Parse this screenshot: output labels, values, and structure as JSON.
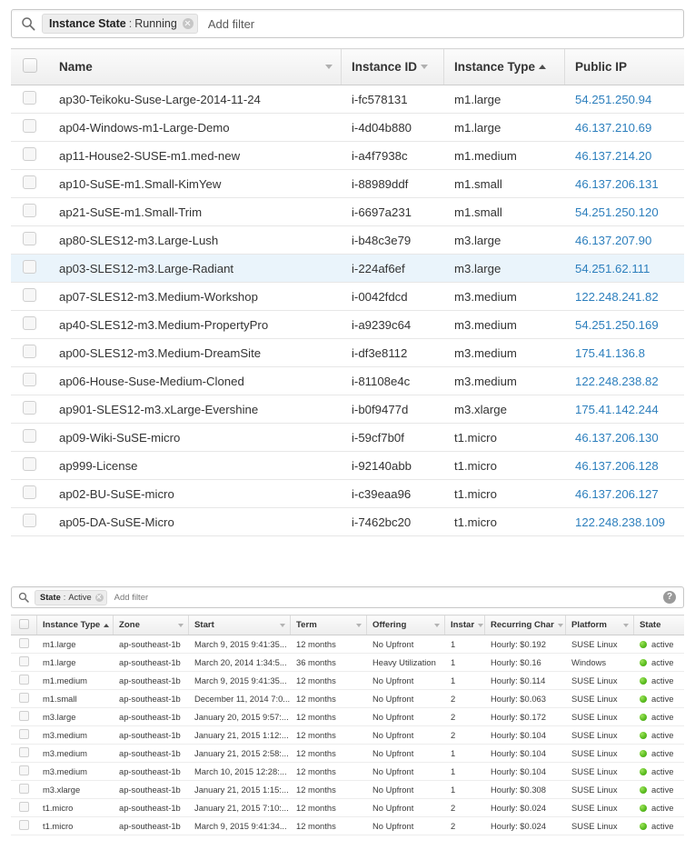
{
  "instances_panel": {
    "filter": {
      "search_icon": "search-icon",
      "token_key": "Instance State",
      "token_sep": ":",
      "token_value": "Running",
      "token_remove_icon": "close-icon",
      "add_filter_label": "Add filter"
    },
    "columns": [
      {
        "label": "Name",
        "sort": "none"
      },
      {
        "label": "Instance ID",
        "sort": "none"
      },
      {
        "label": "Instance Type",
        "sort": "asc"
      },
      {
        "label": "Public IP",
        "sort": "none"
      }
    ],
    "rows": [
      {
        "name": "ap30-Teikoku-Suse-Large-2014-11-24",
        "id": "i-fc578131",
        "type": "m1.large",
        "ip": "54.251.250.94",
        "selected": false
      },
      {
        "name": "ap04-Windows-m1-Large-Demo",
        "id": "i-4d04b880",
        "type": "m1.large",
        "ip": "46.137.210.69",
        "selected": false
      },
      {
        "name": "ap11-House2-SUSE-m1.med-new",
        "id": "i-a4f7938c",
        "type": "m1.medium",
        "ip": "46.137.214.20",
        "selected": false
      },
      {
        "name": "ap10-SuSE-m1.Small-KimYew",
        "id": "i-88989ddf",
        "type": "m1.small",
        "ip": "46.137.206.131",
        "selected": false
      },
      {
        "name": "ap21-SuSE-m1.Small-Trim",
        "id": "i-6697a231",
        "type": "m1.small",
        "ip": "54.251.250.120",
        "selected": false
      },
      {
        "name": "ap80-SLES12-m3.Large-Lush",
        "id": "i-b48c3e79",
        "type": "m3.large",
        "ip": "46.137.207.90",
        "selected": false
      },
      {
        "name": "ap03-SLES12-m3.Large-Radiant",
        "id": "i-224af6ef",
        "type": "m3.large",
        "ip": "54.251.62.111",
        "selected": true
      },
      {
        "name": "ap07-SLES12-m3.Medium-Workshop",
        "id": "i-0042fdcd",
        "type": "m3.medium",
        "ip": "122.248.241.82",
        "selected": false
      },
      {
        "name": "ap40-SLES12-m3.Medium-PropertyPro",
        "id": "i-a9239c64",
        "type": "m3.medium",
        "ip": "54.251.250.169",
        "selected": false
      },
      {
        "name": "ap00-SLES12-m3.Medium-DreamSite",
        "id": "i-df3e8112",
        "type": "m3.medium",
        "ip": "175.41.136.8",
        "selected": false
      },
      {
        "name": "ap06-House-Suse-Medium-Cloned",
        "id": "i-81108e4c",
        "type": "m3.medium",
        "ip": "122.248.238.82",
        "selected": false
      },
      {
        "name": "ap901-SLES12-m3.xLarge-Evershine",
        "id": "i-b0f9477d",
        "type": "m3.xlarge",
        "ip": "175.41.142.244",
        "selected": false
      },
      {
        "name": "ap09-Wiki-SuSE-micro",
        "id": "i-59cf7b0f",
        "type": "t1.micro",
        "ip": "46.137.206.130",
        "selected": false
      },
      {
        "name": "ap999-License",
        "id": "i-92140abb",
        "type": "t1.micro",
        "ip": "46.137.206.128",
        "selected": false
      },
      {
        "name": "ap02-BU-SuSE-micro",
        "id": "i-c39eaa96",
        "type": "t1.micro",
        "ip": "46.137.206.127",
        "selected": false
      },
      {
        "name": "ap05-DA-SuSE-Micro",
        "id": "i-7462bc20",
        "type": "t1.micro",
        "ip": "122.248.238.109",
        "selected": false
      }
    ]
  },
  "reserved_panel": {
    "filter": {
      "search_icon": "search-icon",
      "token_key": "State",
      "token_sep": ":",
      "token_value": "Active",
      "token_remove_icon": "close-icon",
      "add_filter_label": "Add filter",
      "help_icon": "help-icon",
      "help_glyph": "?"
    },
    "columns": [
      {
        "label": "Instance Type",
        "sort": "asc"
      },
      {
        "label": "Zone",
        "sort": "none"
      },
      {
        "label": "Start",
        "sort": "none"
      },
      {
        "label": "Term",
        "sort": "none"
      },
      {
        "label": "Offering",
        "sort": "none"
      },
      {
        "label": "Instar",
        "sort": "none"
      },
      {
        "label": "Recurring Char",
        "sort": "none"
      },
      {
        "label": "Platform",
        "sort": "none"
      },
      {
        "label": "State",
        "sort": "none"
      }
    ],
    "rows": [
      {
        "type": "m1.large",
        "zone": "ap-southeast-1b",
        "start": "March 9, 2015 9:41:35...",
        "term": "12 months",
        "offering": "No Upfront",
        "count": "1",
        "charge": "Hourly: $0.192",
        "platform": "SUSE Linux",
        "state": "active"
      },
      {
        "type": "m1.large",
        "zone": "ap-southeast-1b",
        "start": "March 20, 2014 1:34:5...",
        "term": "36 months",
        "offering": "Heavy Utilization",
        "count": "1",
        "charge": "Hourly: $0.16",
        "platform": "Windows",
        "state": "active"
      },
      {
        "type": "m1.medium",
        "zone": "ap-southeast-1b",
        "start": "March 9, 2015 9:41:35...",
        "term": "12 months",
        "offering": "No Upfront",
        "count": "1",
        "charge": "Hourly: $0.114",
        "platform": "SUSE Linux",
        "state": "active"
      },
      {
        "type": "m1.small",
        "zone": "ap-southeast-1b",
        "start": "December 11, 2014 7:0...",
        "term": "12 months",
        "offering": "No Upfront",
        "count": "2",
        "charge": "Hourly: $0.063",
        "platform": "SUSE Linux",
        "state": "active"
      },
      {
        "type": "m3.large",
        "zone": "ap-southeast-1b",
        "start": "January 20, 2015 9:57:...",
        "term": "12 months",
        "offering": "No Upfront",
        "count": "2",
        "charge": "Hourly: $0.172",
        "platform": "SUSE Linux",
        "state": "active"
      },
      {
        "type": "m3.medium",
        "zone": "ap-southeast-1b",
        "start": "January 21, 2015 1:12:...",
        "term": "12 months",
        "offering": "No Upfront",
        "count": "2",
        "charge": "Hourly: $0.104",
        "platform": "SUSE Linux",
        "state": "active"
      },
      {
        "type": "m3.medium",
        "zone": "ap-southeast-1b",
        "start": "January 21, 2015 2:58:...",
        "term": "12 months",
        "offering": "No Upfront",
        "count": "1",
        "charge": "Hourly: $0.104",
        "platform": "SUSE Linux",
        "state": "active"
      },
      {
        "type": "m3.medium",
        "zone": "ap-southeast-1b",
        "start": "March 10, 2015 12:28:...",
        "term": "12 months",
        "offering": "No Upfront",
        "count": "1",
        "charge": "Hourly: $0.104",
        "platform": "SUSE Linux",
        "state": "active"
      },
      {
        "type": "m3.xlarge",
        "zone": "ap-southeast-1b",
        "start": "January 21, 2015 1:15:...",
        "term": "12 months",
        "offering": "No Upfront",
        "count": "1",
        "charge": "Hourly: $0.308",
        "platform": "SUSE Linux",
        "state": "active"
      },
      {
        "type": "t1.micro",
        "zone": "ap-southeast-1b",
        "start": "January 21, 2015 7:10:...",
        "term": "12 months",
        "offering": "No Upfront",
        "count": "2",
        "charge": "Hourly: $0.024",
        "platform": "SUSE Linux",
        "state": "active"
      },
      {
        "type": "t1.micro",
        "zone": "ap-southeast-1b",
        "start": "March 9, 2015 9:41:34...",
        "term": "12 months",
        "offering": "No Upfront",
        "count": "2",
        "charge": "Hourly: $0.024",
        "platform": "SUSE Linux",
        "state": "active"
      }
    ]
  },
  "colors": {
    "link": "#2d7fbd",
    "selected_row": "#eaf4fb",
    "state_dot": "#5cbe20"
  }
}
